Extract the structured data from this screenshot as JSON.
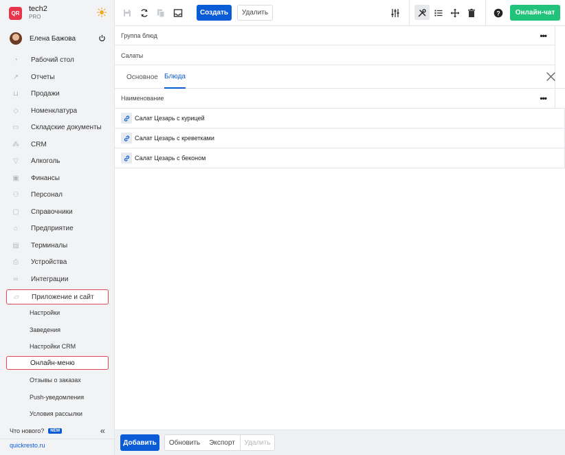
{
  "brand": {
    "logo_text": "QR",
    "name": "tech2",
    "plan": "PRO"
  },
  "user": {
    "name": "Елена Бажова"
  },
  "sidebar": {
    "items": [
      {
        "label": "Рабочий стол",
        "icon": "dashboard-icon"
      },
      {
        "label": "Отчеты",
        "icon": "chart-icon"
      },
      {
        "label": "Продажи",
        "icon": "basket-icon"
      },
      {
        "label": "Номенклатура",
        "icon": "tag-icon"
      },
      {
        "label": "Складские документы",
        "icon": "box-icon"
      },
      {
        "label": "CRM",
        "icon": "people-icon"
      },
      {
        "label": "Алкоголь",
        "icon": "glass-icon"
      },
      {
        "label": "Финансы",
        "icon": "wallet-icon"
      },
      {
        "label": "Персонал",
        "icon": "staff-icon"
      },
      {
        "label": "Справочники",
        "icon": "book-icon"
      },
      {
        "label": "Предприятие",
        "icon": "store-icon"
      },
      {
        "label": "Терминалы",
        "icon": "terminal-icon"
      },
      {
        "label": "Устройства",
        "icon": "printer-icon"
      },
      {
        "label": "Интеграции",
        "icon": "link-icon"
      },
      {
        "label": "Приложение и сайт",
        "icon": "app-icon"
      }
    ],
    "subitems": [
      "Настройки",
      "Заведения",
      "Настройки CRM",
      "Онлайн-меню",
      "Отзывы о заказах",
      "Push-уведомления",
      "Условия рассылки"
    ],
    "whats_new": "Что нового?",
    "new_badge": "NEW",
    "site_link": "quickresto.ru"
  },
  "toolbar": {
    "create_label": "Создать",
    "delete_label": "Удалить",
    "chat_label": "Онлайн-чат"
  },
  "content": {
    "group_label": "Группа блюд",
    "group_value": "Салаты",
    "tabs": [
      "Основное",
      "Блюда"
    ],
    "active_tab": "Блюда",
    "column_header": "Наименование",
    "rows": [
      "Салат Цезарь с курицей",
      "Салат Цезарь с креветками",
      "Салат Цезарь с беконом"
    ]
  },
  "bottom": {
    "add_label": "Добавить",
    "refresh_label": "Обновить",
    "export_label": "Экспорт",
    "delete_label": "Удалить"
  },
  "colors": {
    "accent": "#0a5bd6",
    "chat": "#21c27a",
    "highlight_border": "#e3475b",
    "logo": "#e8344a"
  }
}
